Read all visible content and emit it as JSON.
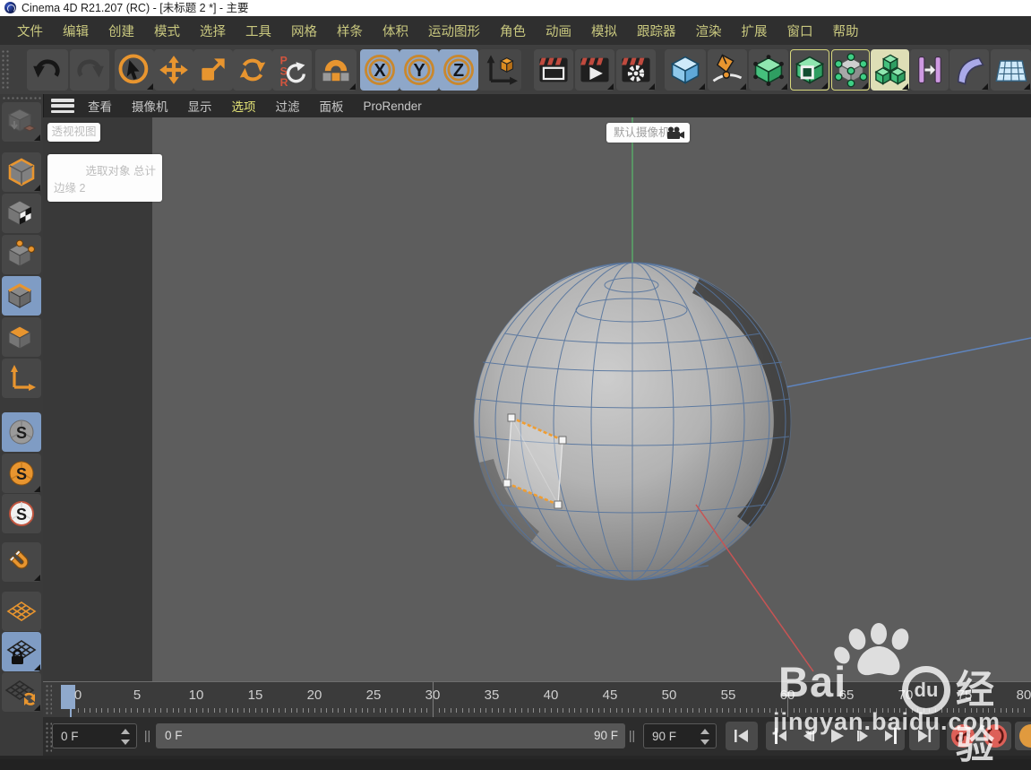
{
  "window": {
    "title": "Cinema 4D R21.207 (RC) - [未标题 2 *] - 主要"
  },
  "menubar": {
    "items": [
      "文件",
      "编辑",
      "创建",
      "模式",
      "选择",
      "工具",
      "网格",
      "样条",
      "体积",
      "运动图形",
      "角色",
      "动画",
      "模拟",
      "跟踪器",
      "渲染",
      "扩展",
      "窗口",
      "帮助"
    ]
  },
  "toolbar": {
    "tools": [
      "undo",
      "redo",
      "live-selection",
      "move",
      "scale",
      "rotate",
      "reset-psr",
      "workplane-modeling",
      "lock-x-axis",
      "lock-y-axis",
      "lock-z-axis",
      "coordinate-system",
      "render-view",
      "render-to-picture-viewer",
      "edit-render-settings",
      "cube-primitive",
      "spline-pen",
      "subdivision-surface",
      "extrude-generator",
      "lattice-generator",
      "volume-builder",
      "symmetry-generator",
      "bend-deformer",
      "floor-object"
    ]
  },
  "glyphs": {
    "x": "X",
    "y": "Y",
    "z": "Z",
    "p": "P",
    "s": "S",
    "r": "R"
  },
  "palette": {
    "modes": [
      "make-editable",
      "model-mode",
      "texture-mode",
      "points-mode",
      "edge-mode",
      "polygon-mode",
      "enable-axis",
      "viewport-solo-off",
      "viewport-solo-single",
      "viewport-solo-hierarchy",
      "enable-snap",
      "workplane-mode",
      "lock-workplane",
      "planar-workplane"
    ],
    "active_modes": [
      "edge-mode",
      "viewport-solo-off",
      "lock-workplane"
    ]
  },
  "viewport": {
    "menu": {
      "items": [
        "查看",
        "摄像机",
        "显示",
        "选项",
        "过滤",
        "面板",
        "ProRender"
      ],
      "active_item": "选项"
    },
    "view_label": "透视视图",
    "selection_hud": {
      "header": "选取对象 总计",
      "row": "边缘  2"
    },
    "camera_label": "默认摄像机",
    "scene": {
      "object": "sphere-wireframe",
      "selected_edges": 2
    }
  },
  "timeline": {
    "ruler_labels": [
      0,
      5,
      10,
      15,
      20,
      25,
      30,
      35,
      40,
      45,
      50,
      55,
      60,
      65,
      70,
      75,
      80
    ],
    "markers": [
      30,
      60
    ],
    "playhead_frame": 0
  },
  "transport": {
    "current_frame": "0 F",
    "range_start": "0 F",
    "range_end": "90 F",
    "end_frame": "90 F",
    "grip": "||"
  },
  "watermark": {
    "brand": "Bai",
    "circle": "du",
    "suffix": "经验",
    "url": "jingyan.baidu.com"
  },
  "colors": {
    "accent_orange": "#e8952f",
    "active_blue": "#7f9cc4",
    "menu_text": "#c9c87f",
    "axis_x_red": "#c75454",
    "axis_y_green": "#58a868",
    "axis_z_blue": "#5e85c0",
    "selection_orange": "#ef9d32",
    "record_red": "#dd6058"
  }
}
